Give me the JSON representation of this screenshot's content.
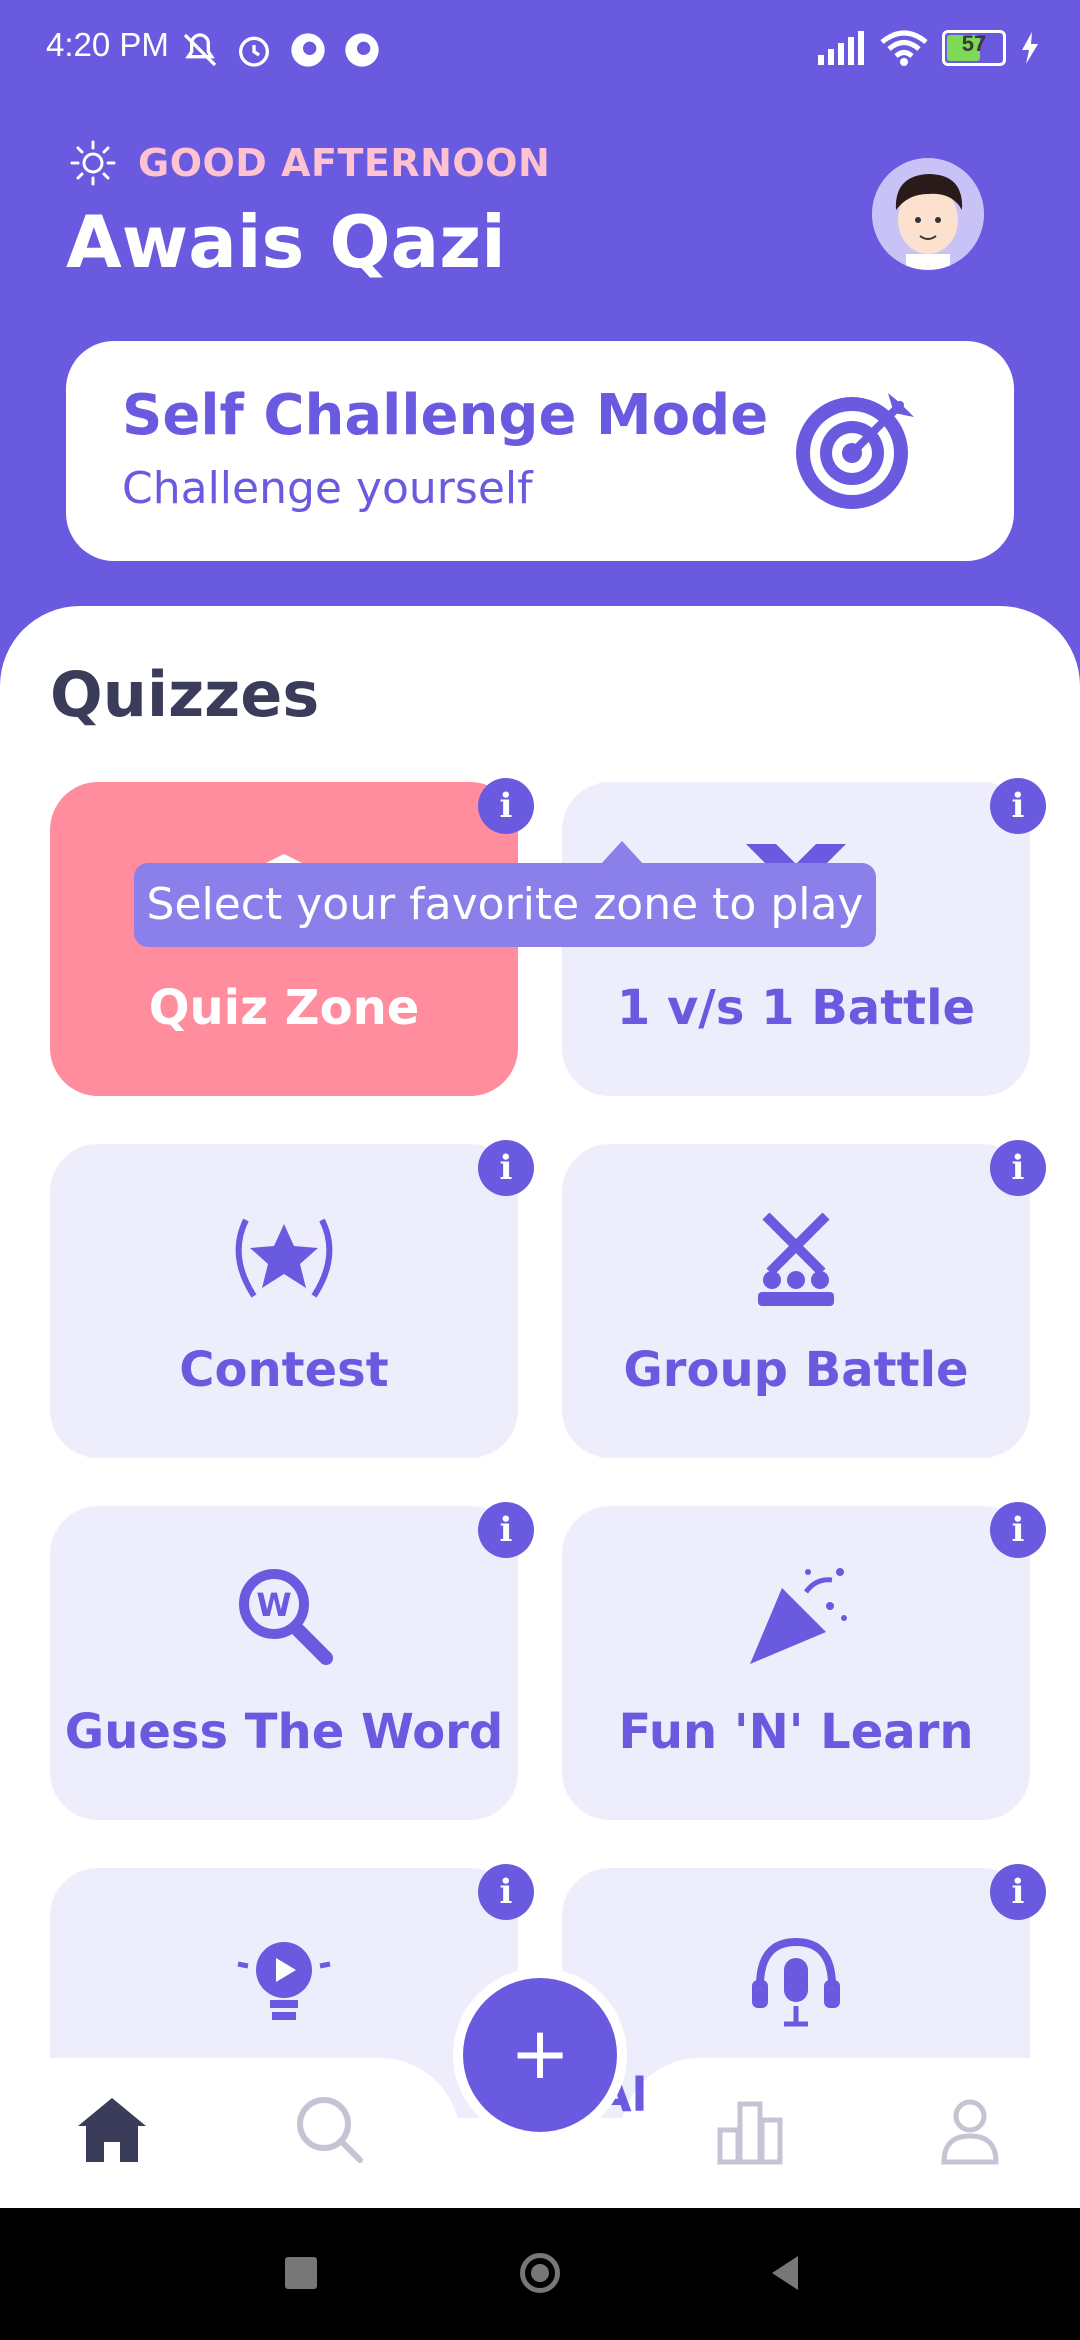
{
  "status_bar": {
    "time": "4:20 PM",
    "battery": "57"
  },
  "header": {
    "greeting": "GOOD AFTERNOON",
    "user_name": "Awais Qazi"
  },
  "challenge_card": {
    "title": "Self Challenge Mode",
    "subtitle": "Challenge yourself"
  },
  "quizzes": {
    "title": "Quizzes",
    "tooltip": "Select your favorite zone to play",
    "cards": [
      {
        "label": "Quiz Zone",
        "icon": "quiz-zone-icon",
        "active": true
      },
      {
        "label": "1 v/s 1 Battle",
        "icon": "battle-icon",
        "active": false
      },
      {
        "label": "Contest",
        "icon": "contest-icon",
        "active": false
      },
      {
        "label": "Group Battle",
        "icon": "group-battle-icon",
        "active": false
      },
      {
        "label": "Guess The Word",
        "icon": "guess-word-icon",
        "active": false
      },
      {
        "label": "Fun 'N' Learn",
        "icon": "fun-learn-icon",
        "active": false
      },
      {
        "label": "",
        "icon": "idea-play-icon",
        "active": false
      },
      {
        "label": "",
        "icon": "audio-icon",
        "active": false
      }
    ],
    "info_glyph": "i"
  },
  "bottom_nav": {
    "fab_label": "+",
    "partial_text": "Al"
  },
  "colors": {
    "primary": "#6A5AE0",
    "accent": "#FF8D9E",
    "card_bg": "#EEEDFC",
    "greeting": "#FFC2D0"
  }
}
